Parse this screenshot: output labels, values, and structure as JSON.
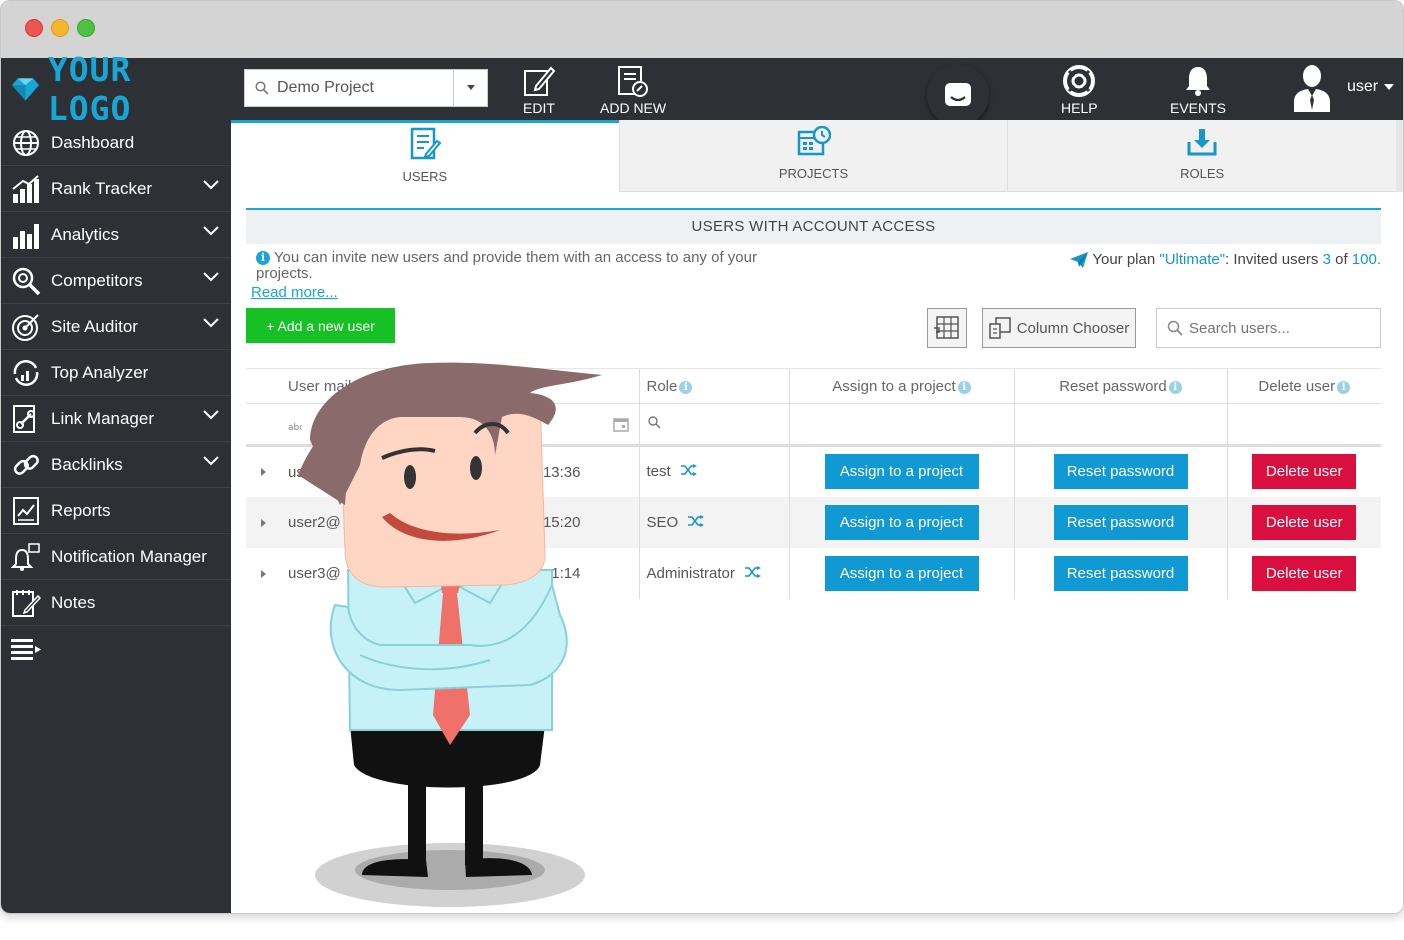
{
  "app": {
    "logo_text": "YOUR LOGO",
    "project_selector": {
      "value": "Demo Project"
    },
    "toolbar": {
      "edit_label": "EDIT",
      "add_new_label": "ADD NEW",
      "help_label": "HELP",
      "events_label": "EVENTS"
    },
    "user_label": "user"
  },
  "sidebar": {
    "items": [
      {
        "label": "Dashboard",
        "icon": "globe-icon",
        "expandable": false
      },
      {
        "label": "Rank Tracker",
        "icon": "rank-chart-icon",
        "expandable": true
      },
      {
        "label": "Analytics",
        "icon": "bar-chart-icon",
        "expandable": true
      },
      {
        "label": "Competitors",
        "icon": "magnifier-icon",
        "expandable": true
      },
      {
        "label": "Site Auditor",
        "icon": "target-icon",
        "expandable": true
      },
      {
        "label": "Top Analyzer",
        "icon": "refresh-chart-icon",
        "expandable": false
      },
      {
        "label": "Link Manager",
        "icon": "link-document-icon",
        "expandable": true
      },
      {
        "label": "Backlinks",
        "icon": "chain-link-icon",
        "expandable": true
      },
      {
        "label": "Reports",
        "icon": "report-icon",
        "expandable": false
      },
      {
        "label": "Notification Manager",
        "icon": "bell-icon",
        "expandable": false
      },
      {
        "label": "Notes",
        "icon": "notepad-icon",
        "expandable": false
      }
    ]
  },
  "tabs": [
    {
      "label": "USERS",
      "active": true
    },
    {
      "label": "PROJECTS",
      "active": false
    },
    {
      "label": "ROLES",
      "active": false
    }
  ],
  "panel": {
    "title": "USERS WITH ACCOUNT ACCESS",
    "info": "You can invite new users and provide them with an access to any of your projects.",
    "read_more": "Read more...",
    "plan_prefix": "Your plan ",
    "plan_name": "\"Ultimate\"",
    "plan_middle": ": Invited users ",
    "invited_count": "3",
    "plan_of": " of ",
    "plan_limit": "100."
  },
  "controls": {
    "add_user": "+ Add a new user",
    "column_chooser": "Column Chooser",
    "search_placeholder": "Search users..."
  },
  "table": {
    "headers": {
      "user_mail": "User mail",
      "role": "Role",
      "assign": "Assign to a project",
      "reset": "Reset password",
      "delete": "Delete user"
    },
    "rows": [
      {
        "mail": "user1@",
        "time": "13:36",
        "role": "test",
        "assign": "Assign to a project",
        "reset": "Reset password",
        "delete": "Delete user"
      },
      {
        "mail": "user2@",
        "time": "15:20",
        "role": "SEO",
        "assign": "Assign to a project",
        "reset": "Reset password",
        "delete": "Delete user"
      },
      {
        "mail": "user3@",
        "time": "1:14",
        "role": "Administrator",
        "assign": "Assign to a project",
        "reset": "Reset password",
        "delete": "Delete user"
      }
    ]
  },
  "colors": {
    "accent": "#17a6d6",
    "dark_bg": "#2d3136",
    "add_button": "#16c125",
    "primary_button": "#1199d3",
    "danger_button": "#d80f3f"
  }
}
